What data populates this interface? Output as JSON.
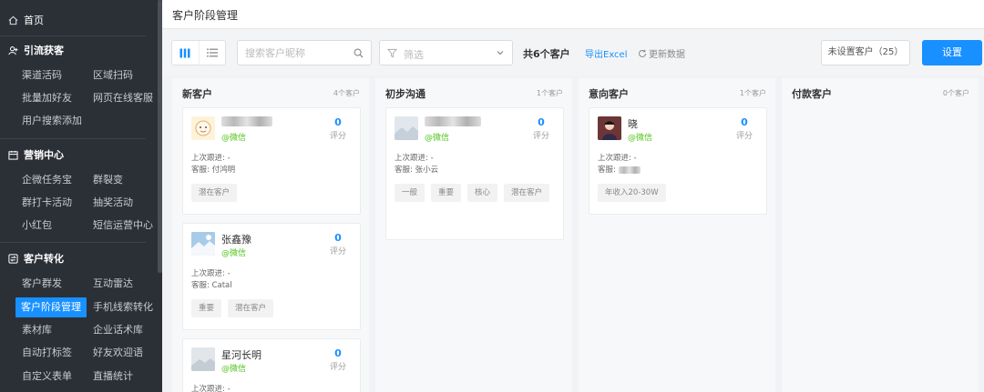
{
  "sidebar": {
    "home": "首页",
    "sections": [
      {
        "title": "引流获客",
        "items": [
          "渠道活码",
          "区域扫码",
          "批量加好友",
          "网页在线客服",
          "用户搜索添加"
        ]
      },
      {
        "title": "营销中心",
        "items": [
          "企微任务宝",
          "群裂变",
          "群打卡活动",
          "抽奖活动",
          "小红包",
          "短信运营中心"
        ]
      },
      {
        "title": "客户转化",
        "items": [
          "客户群发",
          "互动雷达",
          "客户阶段管理",
          "手机线索转化",
          "素材库",
          "企业话术库",
          "自动打标签",
          "好友欢迎语",
          "自定义表单",
          "直播统计"
        ]
      }
    ],
    "active_item": "客户阶段管理"
  },
  "page_title": "客户阶段管理",
  "toolbar": {
    "search_placeholder": "搜索客户昵称",
    "filter_placeholder": "筛选",
    "total_label": "共6个客户",
    "export_label": "导出Excel",
    "refresh_label": "更新数据",
    "unset_label": "未设置客户（25）",
    "settings_label": "设置"
  },
  "columns": [
    {
      "title": "新客户",
      "count": "4个客户",
      "cards": [
        {
          "name": "",
          "source": "@微信",
          "score": "0",
          "score_label": "评分",
          "last_follow": "上次跟进: -",
          "service": "客服: 付鸿明",
          "tags": [
            "潜在客户"
          ]
        },
        {
          "name": "张鑫豫",
          "source": "@微信",
          "score": "0",
          "score_label": "评分",
          "last_follow": "上次跟进: -",
          "service": "客服: Catal",
          "tags": [
            "重要",
            "潜在客户"
          ]
        },
        {
          "name": "星河长明",
          "source": "@微信",
          "score": "0",
          "score_label": "评分",
          "last_follow": "上次跟进: -",
          "service": "",
          "tags": []
        }
      ]
    },
    {
      "title": "初步沟通",
      "count": "1个客户",
      "cards": [
        {
          "name": "",
          "source": "@微信",
          "score": "0",
          "score_label": "评分",
          "last_follow": "上次跟进: -",
          "service": "客服: 张小云",
          "tags": [
            "一般",
            "重要",
            "核心",
            "潜在客户"
          ]
        }
      ]
    },
    {
      "title": "意向客户",
      "count": "1个客户",
      "cards": [
        {
          "name": "晓",
          "source": "@微信",
          "score": "0",
          "score_label": "评分",
          "last_follow": "上次跟进: -",
          "service": "客服:",
          "tags": [
            "年收入20-30W"
          ]
        }
      ]
    },
    {
      "title": "付款客户",
      "count": "0个客户",
      "cards": []
    }
  ]
}
